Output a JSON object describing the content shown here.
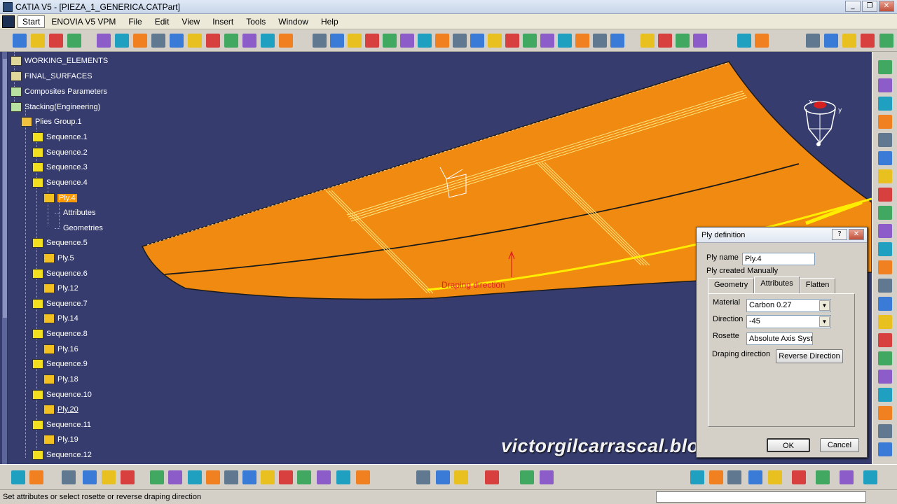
{
  "window": {
    "title": "CATIA V5 - [PIEZA_1_GENERICA.CATPart]",
    "minimize": "_",
    "restore": "❐",
    "close": "✕"
  },
  "menu": {
    "items": [
      "Start",
      "ENOVIA V5 VPM",
      "File",
      "Edit",
      "View",
      "Insert",
      "Tools",
      "Window",
      "Help"
    ]
  },
  "tree": {
    "nodes": [
      {
        "label": "WORKING_ELEMENTS",
        "icon": "geometrical-set-icon"
      },
      {
        "label": "FINAL_SURFACES",
        "icon": "geometrical-set-icon"
      },
      {
        "label": "Composites Parameters",
        "icon": "composites-parameters-icon"
      },
      {
        "label": "Stacking(Engineering)",
        "icon": "stacking-icon"
      },
      {
        "label": "Plies Group.1",
        "icon": "plies-group-icon"
      },
      {
        "label": "Sequence.1",
        "icon": "sequence-icon"
      },
      {
        "label": "Sequence.2",
        "icon": "sequence-icon"
      },
      {
        "label": "Sequence.3",
        "icon": "sequence-icon"
      },
      {
        "label": "Sequence.4",
        "icon": "sequence-icon"
      },
      {
        "label": "Ply.4",
        "icon": "ply-icon",
        "state": "selected"
      },
      {
        "label": "Attributes",
        "icon": "none"
      },
      {
        "label": "Geometries",
        "icon": "none"
      },
      {
        "label": "Sequence.5",
        "icon": "sequence-icon"
      },
      {
        "label": "Ply.5",
        "icon": "ply-icon"
      },
      {
        "label": "Sequence.6",
        "icon": "sequence-icon"
      },
      {
        "label": "Ply.12",
        "icon": "ply-icon"
      },
      {
        "label": "Sequence.7",
        "icon": "sequence-icon"
      },
      {
        "label": "Ply.14",
        "icon": "ply-icon"
      },
      {
        "label": "Sequence.8",
        "icon": "sequence-icon"
      },
      {
        "label": "Ply.16",
        "icon": "ply-icon"
      },
      {
        "label": "Sequence.9",
        "icon": "sequence-icon"
      },
      {
        "label": "Ply.18",
        "icon": "ply-icon"
      },
      {
        "label": "Sequence.10",
        "icon": "sequence-icon"
      },
      {
        "label": "Ply.20",
        "icon": "ply-icon",
        "state": "underlined"
      },
      {
        "label": "Sequence.11",
        "icon": "sequence-icon"
      },
      {
        "label": "Ply.19",
        "icon": "ply-icon"
      },
      {
        "label": "Sequence.12",
        "icon": "sequence-icon"
      }
    ]
  },
  "viewport": {
    "draping_label": "Draping direction",
    "watermark": "victorgilcarrascal.blogspot.com.es",
    "compass_axes": [
      "x",
      "y",
      "z"
    ]
  },
  "dialog": {
    "title": "Ply definition",
    "help_button": "?",
    "close_button": "✕",
    "ply_name_label": "Ply name",
    "ply_name_value": "Ply.4",
    "created_text": "Ply created Manually",
    "tabs": [
      "Geometry",
      "Attributes",
      "Flatten"
    ],
    "active_tab": "Attributes",
    "material_label": "Material",
    "material_value": "Carbon 0.27",
    "direction_label": "Direction",
    "direction_value": "-45",
    "rosette_label": "Rosette",
    "rosette_value": "Absolute Axis Syste",
    "draping_label": "Draping direction",
    "reverse_button": "Reverse Direction",
    "ok_button": "OK",
    "cancel_button": "Cancel"
  },
  "status": {
    "message": "Set attributes or select rosette or reverse draping direction"
  },
  "colors": {
    "viewport_bg": "#363d6e",
    "part_orange": "#f08a10",
    "selected_highlight": "#ff9900"
  }
}
